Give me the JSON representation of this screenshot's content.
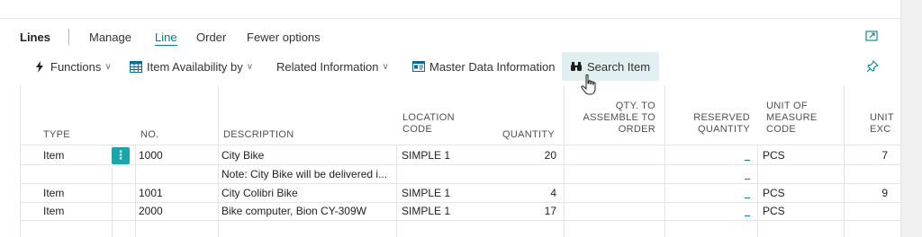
{
  "part": {
    "title": "Lines",
    "tabs": [
      {
        "label": "Manage"
      },
      {
        "label": "Line"
      },
      {
        "label": "Order"
      },
      {
        "label": "Fewer options"
      }
    ]
  },
  "actions": {
    "functions": "Functions",
    "item_availability": "Item Availability by",
    "related_information": "Related Information",
    "master_data_information": "Master Data Information",
    "search_item": "Search Item"
  },
  "colors": {
    "accent": "#00808a",
    "row_menu": "#1aa5a9",
    "highlight": "#e2eff0"
  },
  "grid": {
    "columns": {
      "type": "TYPE",
      "no": "NO.",
      "description": "DESCRIPTION",
      "location_line1": "LOCATION",
      "location_line2": "CODE",
      "quantity": "QUANTITY",
      "qty_assemble_line1": "QTY. TO",
      "qty_assemble_line2": "ASSEMBLE TO",
      "qty_assemble_line3": "ORDER",
      "reserved_line1": "RESERVED",
      "reserved_line2": "QUANTITY",
      "uom_line1": "UNIT OF",
      "uom_line2": "MEASURE",
      "uom_line3": "CODE",
      "unit_line1": "UNIT",
      "unit_line2": "EXC"
    },
    "row_menu_glyph": "⋮",
    "rows": [
      {
        "type": "Item",
        "no": "1000",
        "description": "City Bike",
        "location": "SIMPLE 1",
        "quantity": "20",
        "uom": "PCS",
        "unit": "7"
      },
      {
        "type": "",
        "no": "",
        "description": "Note: City Bike will be delivered i...",
        "location": "",
        "quantity": "",
        "uom": "",
        "unit": ""
      },
      {
        "type": "Item",
        "no": "1001",
        "description": "City Colibri Bike",
        "location": "SIMPLE 1",
        "quantity": "4",
        "uom": "PCS",
        "unit": "9"
      },
      {
        "type": "Item",
        "no": "2000",
        "description": "Bike computer, Bion CY-309W",
        "location": "SIMPLE 1",
        "quantity": "17",
        "uom": "PCS",
        "unit": ""
      }
    ]
  }
}
